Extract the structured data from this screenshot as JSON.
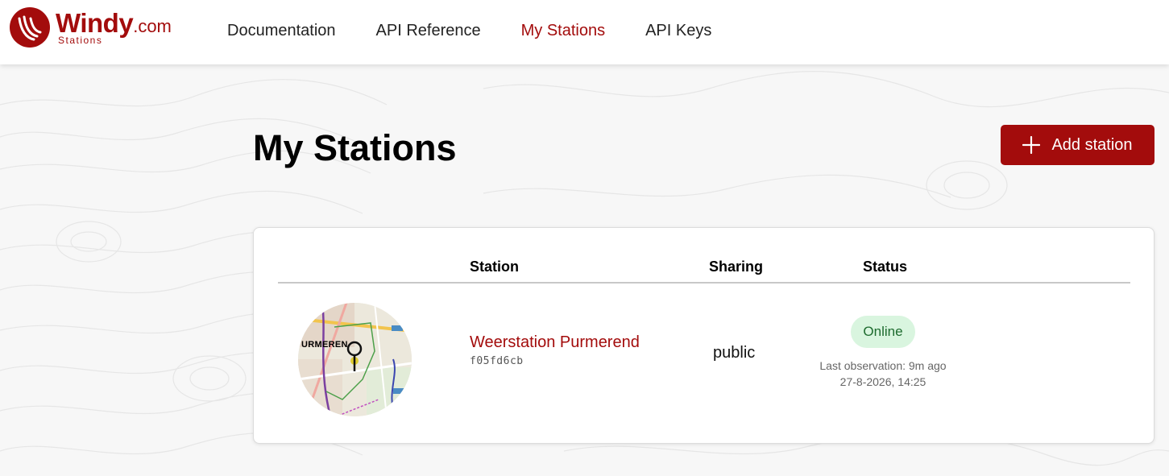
{
  "brand": {
    "name": "Windy",
    "suffix": ".com",
    "subtitle": "Stations",
    "color": "#a30c0c"
  },
  "nav": {
    "items": [
      {
        "label": "Documentation",
        "active": false
      },
      {
        "label": "API Reference",
        "active": false
      },
      {
        "label": "My Stations",
        "active": true
      },
      {
        "label": "API Keys",
        "active": false
      }
    ]
  },
  "page": {
    "title": "My Stations",
    "add_button_label": "Add station",
    "add_button_icon": "plus-icon"
  },
  "table": {
    "columns": {
      "station": "Station",
      "sharing": "Sharing",
      "status": "Status"
    },
    "rows": [
      {
        "map_label": "URMEREN",
        "name": "Weerstation Purmerend",
        "id": "f05fd6cb",
        "sharing": "public",
        "status": "Online",
        "last_observation": "Last observation: 9m ago",
        "timestamp": "27-8-2026, 14:25"
      }
    ]
  },
  "colors": {
    "accent": "#a30c0c",
    "online_bg": "#d9f5df",
    "online_text": "#1d6b2e"
  }
}
